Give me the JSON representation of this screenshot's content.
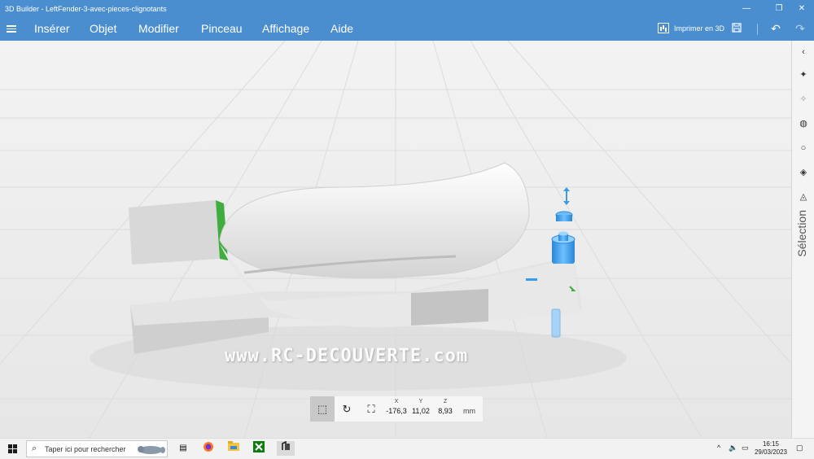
{
  "window": {
    "title": "3D Builder - LeftFender-3-avec-pieces-clignotants",
    "minimize_glyph": "—",
    "maximize_glyph": "❐",
    "close_glyph": "✕"
  },
  "menu": {
    "items": [
      "Insérer",
      "Objet",
      "Modifier",
      "Pinceau",
      "Affichage",
      "Aide"
    ],
    "print_label": "Imprimer en 3D"
  },
  "toolbar_icons": [
    "save-icon",
    "undo-icon",
    "redo-icon"
  ],
  "viewport": {
    "watermark": "www.RC-DECOUVERTE.com"
  },
  "rail": {
    "label": "Sélection",
    "icons": [
      "collapse-icon",
      "select-all-icon",
      "select-objects-icon",
      "select-faces-icon",
      "select-circle-icon",
      "select-edges-icon",
      "select-vertices-icon"
    ]
  },
  "transform": {
    "tools": [
      "move-icon",
      "rotate-icon",
      "scale-icon"
    ],
    "x_label": "X",
    "x_value": "-176,3",
    "y_label": "Y",
    "y_value": "11,02",
    "z_label": "Z",
    "z_value": "8,93",
    "unit": "mm"
  },
  "taskbar": {
    "search_placeholder": "Taper ici pour rechercher",
    "apps": [
      "task-view-icon",
      "firefox-icon",
      "file-explorer-icon",
      "xbox-icon",
      "3d-builder-icon"
    ],
    "time": "16:15",
    "date": "29/03/2023"
  },
  "colors": {
    "accent": "#4a8ed0",
    "model": "#dcdcdc",
    "gizmo": "#3a9be8",
    "green_face": "#3fae3f"
  }
}
